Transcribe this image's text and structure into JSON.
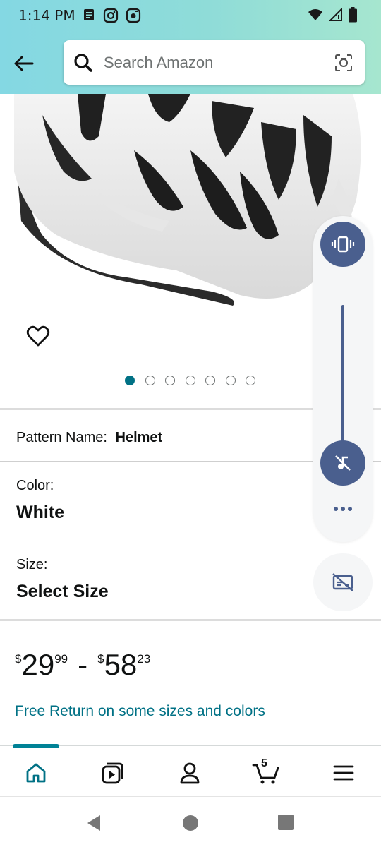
{
  "status_bar": {
    "time": "1:14 PM",
    "left_icons": [
      "notes-icon",
      "instagram-icon",
      "camera-app-icon"
    ],
    "right_icons": [
      "wifi-icon",
      "signal-icon",
      "battery-icon"
    ]
  },
  "header": {
    "back_icon": "back-arrow-icon",
    "search": {
      "placeholder": "Search Amazon",
      "icon": "search-icon",
      "camera_icon": "camera-scan-icon"
    }
  },
  "product": {
    "image_alt": "White bicycle helmet",
    "wishlist_icon": "heart-icon",
    "carousel": {
      "total": 7,
      "active_index": 0
    }
  },
  "options": {
    "pattern": {
      "label": "Pattern Name:",
      "value": "Helmet"
    },
    "color": {
      "label": "Color:",
      "value": "White"
    },
    "size": {
      "label": "Size:",
      "value": "Select Size"
    }
  },
  "price": {
    "low": {
      "currency": "$",
      "whole": "29",
      "fraction": "99"
    },
    "separator": "-",
    "high": {
      "currency": "$",
      "whole": "58",
      "fraction": "23"
    }
  },
  "free_return": "Free Return on some sizes and colors",
  "bottom_nav": {
    "items": [
      "home-icon",
      "video-icon",
      "account-icon",
      "cart-icon",
      "menu-icon"
    ],
    "cart_count": "5"
  },
  "volume_overlay": {
    "ring_mode_icon": "vibrate-icon",
    "media_icon": "music-off-icon",
    "more_icon": "more-dots-icon",
    "caption_icon": "caption-off-icon",
    "colors": {
      "accent": "#4a5f8e",
      "panel": "#f5f6f7"
    }
  },
  "colors": {
    "teal_link": "#007185",
    "nav_indicator": "#008296"
  }
}
